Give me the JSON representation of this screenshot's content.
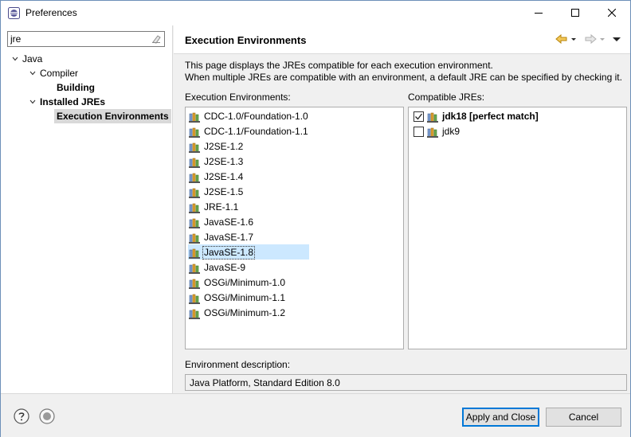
{
  "window": {
    "title": "Preferences"
  },
  "sidebar": {
    "filter_value": "jre",
    "tree": [
      {
        "label": "Java",
        "level": 0,
        "expanded": true,
        "bold": false
      },
      {
        "label": "Compiler",
        "level": 1,
        "expanded": true,
        "bold": false
      },
      {
        "label": "Building",
        "level": 2,
        "expanded": false,
        "bold": true
      },
      {
        "label": "Installed JREs",
        "level": 1,
        "expanded": true,
        "bold": true
      },
      {
        "label": "Execution Environments",
        "level": 2,
        "expanded": false,
        "bold": true,
        "selected": true
      }
    ]
  },
  "page": {
    "title": "Execution Environments",
    "description_line1": "This page displays the JREs compatible for each execution environment.",
    "description_line2": "When multiple JREs are compatible with an environment, a default JRE can be specified by checking it.",
    "environments_label": "Execution Environments:",
    "environments": [
      "CDC-1.0/Foundation-1.0",
      "CDC-1.1/Foundation-1.1",
      "J2SE-1.2",
      "J2SE-1.3",
      "J2SE-1.4",
      "J2SE-1.5",
      "JRE-1.1",
      "JavaSE-1.6",
      "JavaSE-1.7",
      "JavaSE-1.8",
      "JavaSE-9",
      "OSGi/Minimum-1.0",
      "OSGi/Minimum-1.1",
      "OSGi/Minimum-1.2"
    ],
    "selected_environment": "JavaSE-1.8",
    "compatible_label": "Compatible JREs:",
    "compatible_jres": [
      {
        "label": "jdk18 [perfect match]",
        "checked": true,
        "bold": true
      },
      {
        "label": "jdk9",
        "checked": false,
        "bold": false
      }
    ],
    "env_description_label": "Environment description:",
    "env_description_value": "Java Platform, Standard Edition 8.0"
  },
  "buttons": {
    "apply_close": "Apply and Close",
    "cancel": "Cancel"
  },
  "icons": {
    "help": "help-icon",
    "import_export": "import-export-icon",
    "back": "back-arrow-icon",
    "forward": "forward-arrow-icon",
    "menu": "view-menu-icon"
  },
  "colors": {
    "selection": "#cce8ff",
    "default_button_border": "#0078d7",
    "back_arrow": "#e8b830"
  }
}
